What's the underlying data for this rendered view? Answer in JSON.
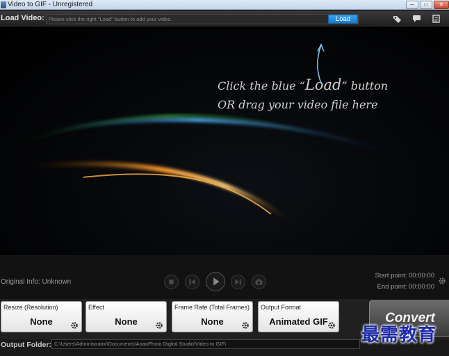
{
  "window": {
    "title": "Video to GIF - Unregistered",
    "minimize": "─",
    "maximize": "□",
    "close": "✕"
  },
  "loadbar": {
    "label": "Load Video:",
    "placeholder": "Please click the right \"Load\" button to add your video.",
    "load_button": "Load",
    "icons": [
      "tag-icon",
      "comment-icon",
      "register-icon"
    ]
  },
  "preview": {
    "hint_line1_pre": "Click the blue “",
    "hint_line1_big": "Load",
    "hint_line1_post": "” button",
    "hint_line2": "OR drag your video file here"
  },
  "controls": {
    "original_info": "Original Info: Unknown",
    "start_point": "Start point: 00:00:00",
    "end_point": "End point: 00:00:00"
  },
  "settings": {
    "cards": [
      {
        "title": "Resize (Resolution)",
        "value": "None"
      },
      {
        "title": "Effect",
        "value": "None"
      },
      {
        "title": "Frame Rate (Total Frames)",
        "value": "None"
      },
      {
        "title": "Output Format",
        "value": "Animated GIF"
      }
    ],
    "convert": "Convert"
  },
  "output": {
    "label": "Output Folder:",
    "path": "C:\\Users\\Administrator\\Documents\\AoaoPhoto Digital Studio\\Video to GIF\\"
  },
  "watermark": "最需教育",
  "colors": {
    "accent_blue": "#1a79c9",
    "background": "#000000"
  }
}
